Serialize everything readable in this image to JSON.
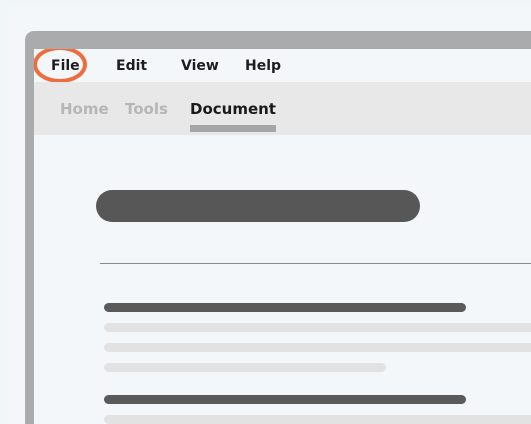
{
  "menubar": {
    "items": [
      {
        "label": "File",
        "highlighted": true
      },
      {
        "label": "Edit"
      },
      {
        "label": "View"
      },
      {
        "label": "Help"
      }
    ]
  },
  "tabs": {
    "items": [
      {
        "label": "Home",
        "active": false
      },
      {
        "label": "Tools",
        "active": false
      },
      {
        "label": "Document",
        "active": true
      }
    ]
  },
  "colors": {
    "highlight": "#ee6d3f",
    "frame": "#a9abad",
    "tab_bar": "#e8e8e8",
    "placeholder_dark": "#575757",
    "placeholder_light": "#e2e2e2"
  }
}
